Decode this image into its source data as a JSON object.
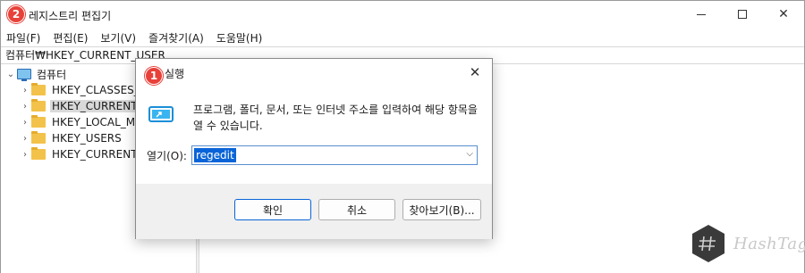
{
  "regedit": {
    "title": "레지스트리 편집기",
    "menu": [
      "파일(F)",
      "편집(E)",
      "보기(V)",
      "즐겨찾기(A)",
      "도움말(H)"
    ],
    "address": "컴퓨터₩HKEY_CURRENT_USER",
    "tree": {
      "root": "컴퓨터",
      "items": [
        "HKEY_CLASSES_R",
        "HKEY_CURRENT_U",
        "HKEY_LOCAL_MA",
        "HKEY_USERS",
        "HKEY_CURRENT_C"
      ]
    }
  },
  "badges": {
    "step1": "1",
    "step2": "2"
  },
  "run_dialog": {
    "title": "실행",
    "description": "프로그램, 폴더, 문서, 또는 인터넷 주소를 입력하여 해당 항목을 열 수 있습니다.",
    "open_label": "열기(O):",
    "open_value": "regedit",
    "ok_label": "확인",
    "cancel_label": "취소",
    "browse_label": "찾아보기(B)..."
  },
  "watermark": {
    "text": "HashTag"
  },
  "colors": {
    "badge": "#e8413a",
    "selection": "#0a64d8",
    "folder": "#f3c24a"
  }
}
